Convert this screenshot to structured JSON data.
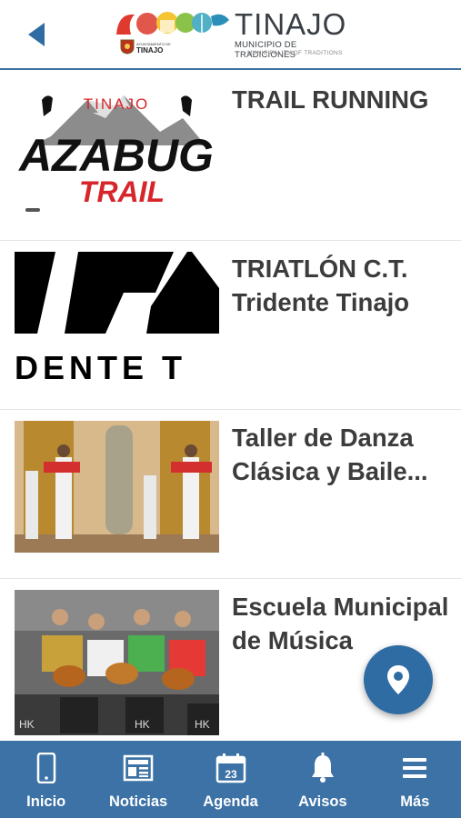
{
  "header": {
    "back_icon": "chevron-left-icon",
    "logo": {
      "title": "TINAJO",
      "subtitle": "MUNICIPIO DE TRADICIONES",
      "subtitle_en": "MUNICIPALITY OF TRADITIONS",
      "seal_label_small": "AYUNTAMIENTO DE",
      "seal_label": "TINAJO"
    }
  },
  "items": [
    {
      "title": "TRAIL RUNNING",
      "thumb_text_top": "TINAJO",
      "thumb_text_main": "AZABUG",
      "thumb_text_sub": "TRAIL"
    },
    {
      "title": "TRIATLÓN C.T. Tridente Tinajo",
      "thumb_text": "DENTE T"
    },
    {
      "title": "Taller de Danza Clásica y Baile..."
    },
    {
      "title": "Escuela Municipal de Música",
      "thumb_text": "HK"
    }
  ],
  "fab": {
    "icon": "map-pin-icon"
  },
  "nav": [
    {
      "label": "Inicio",
      "icon": "phone-icon"
    },
    {
      "label": "Noticias",
      "icon": "newspaper-icon"
    },
    {
      "label": "Agenda",
      "icon": "calendar-icon",
      "badge": "23"
    },
    {
      "label": "Avisos",
      "icon": "bell-icon"
    },
    {
      "label": "Más",
      "icon": "menu-icon"
    }
  ],
  "colors": {
    "primary": "#3d72a6",
    "fab": "#2f6ca3",
    "text": "#3c3c3c"
  }
}
